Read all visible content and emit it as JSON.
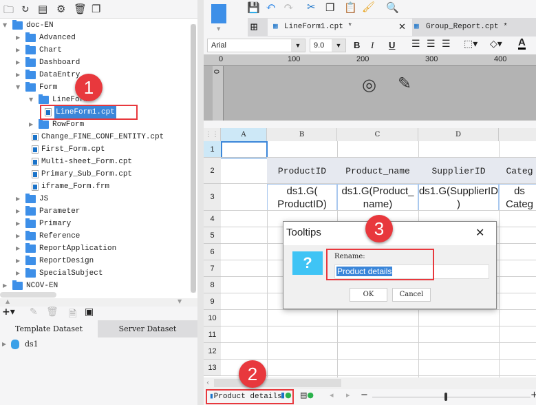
{
  "left_toolbar": {
    "icons": [
      "new-folder-icon",
      "refresh-icon",
      "template-icon",
      "settings-icon",
      "delete-icon",
      "copy-icon"
    ]
  },
  "tree": [
    {
      "label": "doc-EN",
      "type": "folder",
      "level": 0,
      "expanded": true
    },
    {
      "label": "Advanced",
      "type": "folder",
      "level": 1
    },
    {
      "label": "Chart",
      "type": "folder",
      "level": 1
    },
    {
      "label": "Dashboard",
      "type": "folder",
      "level": 1
    },
    {
      "label": "DataEntry",
      "type": "folder",
      "level": 1
    },
    {
      "label": "Form",
      "type": "folder",
      "level": 1,
      "expanded": true
    },
    {
      "label": "LineForm",
      "type": "folder",
      "level": 2,
      "expanded": true
    },
    {
      "label": "LineForm1.cpt",
      "type": "file",
      "level": 3,
      "selected": true
    },
    {
      "label": "RowForm",
      "type": "folder",
      "level": 2
    },
    {
      "label": "Change_FINE_CONF_ENTITY.cpt",
      "type": "file",
      "level": 2
    },
    {
      "label": "First_Form.cpt",
      "type": "file",
      "level": 2
    },
    {
      "label": "Multi-sheet_Form.cpt",
      "type": "file",
      "level": 2
    },
    {
      "label": "Primary_Sub_Form.cpt",
      "type": "file",
      "level": 2
    },
    {
      "label": "iframe_Form.frm",
      "type": "file",
      "level": 2
    },
    {
      "label": "JS",
      "type": "folder",
      "level": 1
    },
    {
      "label": "Parameter",
      "type": "folder",
      "level": 1
    },
    {
      "label": "Primary",
      "type": "folder",
      "level": 1
    },
    {
      "label": "Reference",
      "type": "folder",
      "level": 1
    },
    {
      "label": "ReportApplication",
      "type": "folder",
      "level": 1
    },
    {
      "label": "ReportDesign",
      "type": "folder",
      "level": 1
    },
    {
      "label": "SpecialSubject",
      "type": "folder",
      "level": 1
    },
    {
      "label": "NCOV-EN",
      "type": "folder",
      "level": 0
    }
  ],
  "dataset": {
    "tabs": [
      "Template Dataset",
      "Server Dataset"
    ],
    "items": [
      "ds1"
    ]
  },
  "tabs": [
    {
      "label": "LineForm1.cpt *",
      "active": true
    },
    {
      "label": "Group_Report.cpt *",
      "active": false
    }
  ],
  "format": {
    "font": "Arial",
    "size": "9.0",
    "bold": "B",
    "italic": "I",
    "underline": "U",
    "font_color": "A"
  },
  "ruler": {
    "ticks": [
      "0",
      "100",
      "200",
      "300",
      "400"
    ],
    "vertical": "0"
  },
  "grid": {
    "columns": [
      "A",
      "B",
      "C",
      "D"
    ],
    "rows": [
      "1",
      "2",
      "3",
      "4",
      "5",
      "6",
      "7",
      "8",
      "9",
      "10",
      "11",
      "12",
      "13"
    ],
    "header_cells": [
      "ProductID",
      "Product_name",
      "SupplierID",
      "Categ"
    ],
    "data_cells": [
      "ds1.G(\nProductID)",
      "ds1.G(Product_\nname)",
      "ds1.G(SupplierID\n)",
      "ds\nCateg"
    ]
  },
  "dialog": {
    "title": "Tooltips",
    "rename_label": "Rename:",
    "rename_value": "Product details",
    "ok": "OK",
    "cancel": "Cancel"
  },
  "sheet_tab": {
    "label": "Product details"
  },
  "badges": [
    "1",
    "2",
    "3"
  ],
  "colors": {
    "accent": "#3d8fe8",
    "highlight": "#e8383d",
    "selection": "#3b86d9"
  }
}
